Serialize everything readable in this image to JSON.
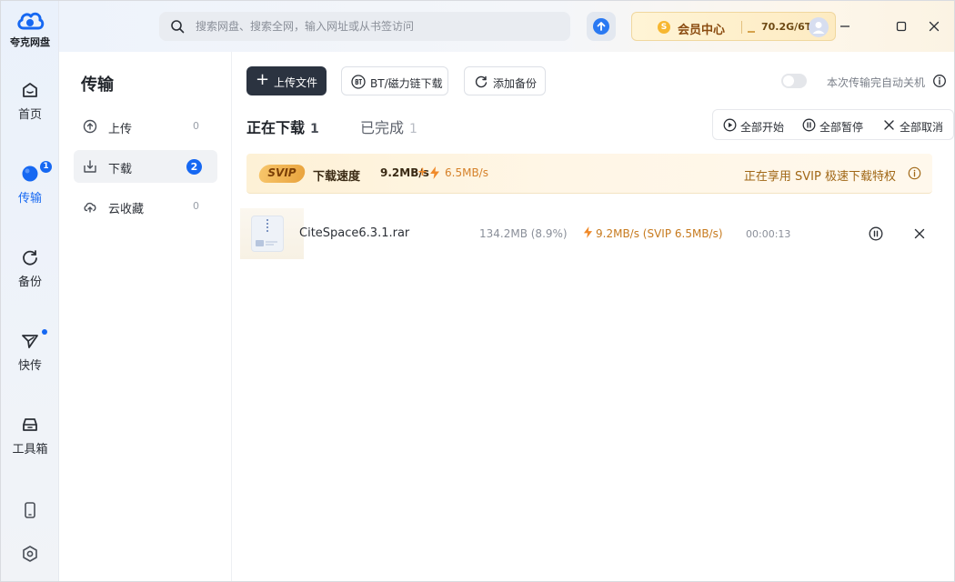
{
  "app": {
    "logo_text": "夸克网盘"
  },
  "rail": {
    "items": [
      {
        "label": "首页",
        "icon": "home-icon"
      },
      {
        "label": "传输",
        "icon": "transfer-icon",
        "badge": "1"
      },
      {
        "label": "备份",
        "icon": "backup-icon"
      },
      {
        "label": "快传",
        "icon": "send-icon"
      },
      {
        "label": "工具箱",
        "icon": "toolbox-icon"
      }
    ],
    "bottom": [
      {
        "icon": "phone-icon"
      },
      {
        "icon": "settings-icon"
      }
    ]
  },
  "topbar": {
    "search_placeholder": "搜索网盘、搜索全网，输入网址或从书签访问",
    "member_label": "会员中心",
    "coin_letter": "S",
    "storage": "70.2G/6T"
  },
  "sidebar": {
    "title": "传输",
    "items": [
      {
        "label": "上传",
        "count": "0"
      },
      {
        "label": "下载",
        "count": "2"
      },
      {
        "label": "云收藏",
        "count": "0"
      }
    ]
  },
  "toolbar": {
    "upload_label": "上传文件",
    "bt_label": "BT/磁力链下载",
    "backup_label": "添加备份",
    "auto_shutdown_label": "本次传输完自动关机"
  },
  "tabs": [
    {
      "label": "正在下载",
      "count": "1"
    },
    {
      "label": "已完成",
      "count": "1"
    }
  ],
  "controls": {
    "start_all": "全部开始",
    "pause_all": "全部暂停",
    "cancel_all": "全部取消"
  },
  "svip": {
    "badge": "SVIP",
    "speed_label": "下载速度",
    "speed": "9.2MB/s",
    "plus": "+",
    "extra": "6.5MB/s",
    "privilege": "正在享用 SVIP 极速下载特权"
  },
  "downloads": [
    {
      "name": "CiteSpace6.3.1.rar",
      "size": "134.2MB (8.9%)",
      "speed": "9.2MB/s (SVIP 6.5MB/s)",
      "time": "00:00:13",
      "progress": 0.089
    }
  ],
  "colors": {
    "accent": "#1668f2",
    "primary_button": "#2b3340",
    "svip_text": "#a06716"
  }
}
